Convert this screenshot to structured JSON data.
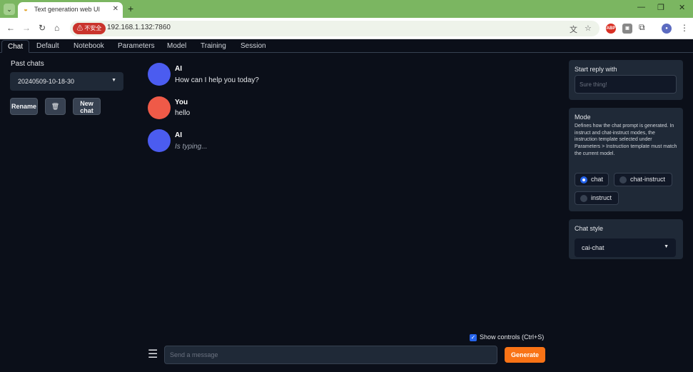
{
  "browser": {
    "tab_title": "Text generation web UI",
    "security_badge": "⚠ 不安全",
    "url": "192.168.1.132:7860"
  },
  "app_tabs": [
    "Chat",
    "Default",
    "Notebook",
    "Parameters",
    "Model",
    "Training",
    "Session"
  ],
  "left_panel": {
    "past_chats_label": "Past chats",
    "selected_chat": "20240509-10-18-30",
    "rename_label": "Rename",
    "delete_glyph": "🗑",
    "new_chat_label": "New\nchat"
  },
  "messages": [
    {
      "name": "AI",
      "text": "How can I help you today?"
    },
    {
      "name": "You",
      "text": "hello"
    },
    {
      "name": "AI",
      "text": "Is typing..."
    }
  ],
  "input": {
    "show_controls_label": "Show controls (Ctrl+S)",
    "show_controls_checked": true,
    "message_placeholder": "Send a message",
    "generate_label": "Generate"
  },
  "right_panel": {
    "start_reply_title": "Start reply with",
    "start_reply_placeholder": "Sure thing!",
    "mode_title": "Mode",
    "mode_description": "Defines how the chat prompt is generated. In instruct and chat-instruct modes, the instruction template selected under Parameters > Instruction template must match the current model.",
    "mode_options": [
      "chat",
      "chat-instruct",
      "instruct"
    ],
    "mode_selected": "chat",
    "chat_style_title": "Chat style",
    "chat_style_value": "cai-chat"
  },
  "colors": {
    "background": "#0b0f19",
    "panel": "#1f2937",
    "ai_avatar": "#4b5cf0",
    "user_avatar": "#ef5a48",
    "generate_button": "#f97316",
    "browser_frame": "#7bb661"
  }
}
